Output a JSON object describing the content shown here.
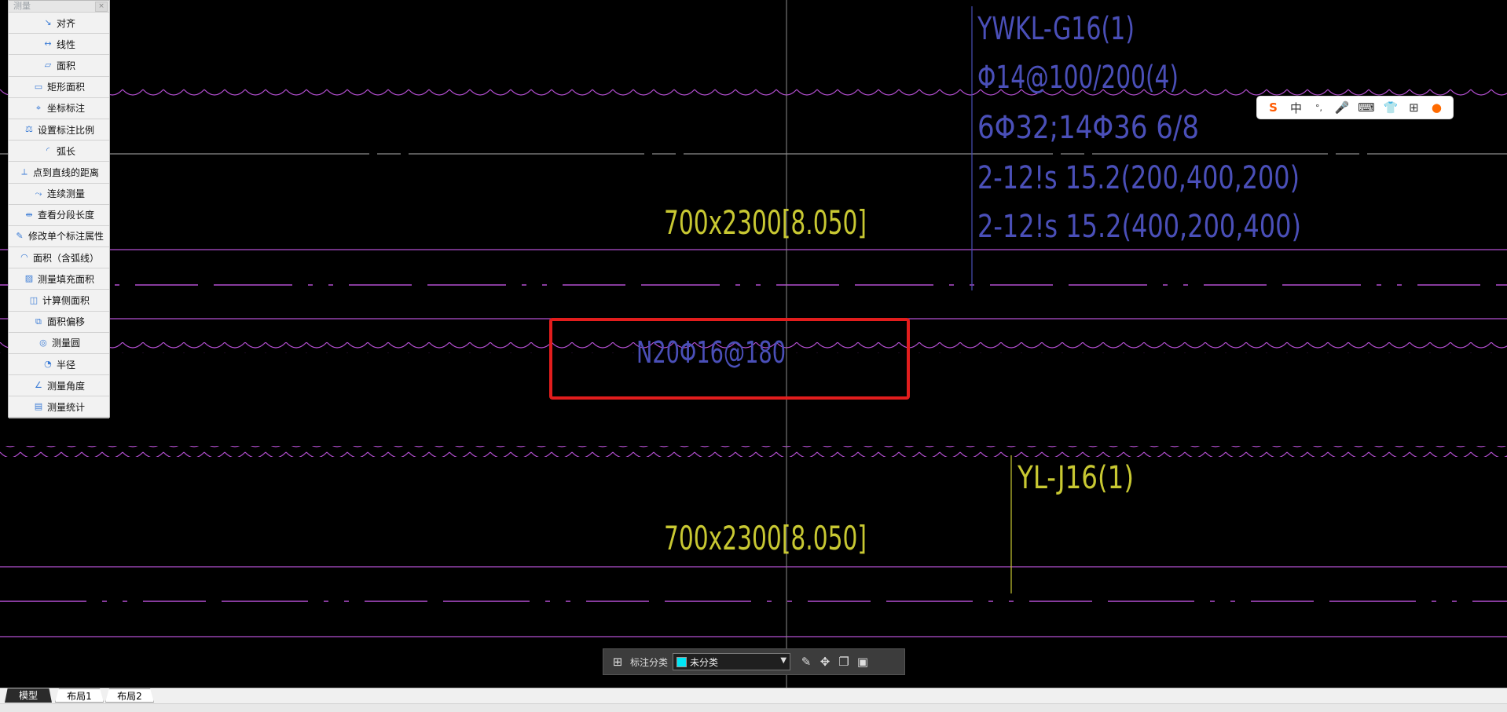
{
  "measure_panel": {
    "title": "测量",
    "items": [
      {
        "label": "对齐",
        "icon": "align-measure-icon"
      },
      {
        "label": "线性",
        "icon": "linear-measure-icon"
      },
      {
        "label": "面积",
        "icon": "area-icon"
      },
      {
        "label": "矩形面积",
        "icon": "rect-area-icon"
      },
      {
        "label": "坐标标注",
        "icon": "coordinate-icon"
      },
      {
        "label": "设置标注比例",
        "icon": "scale-icon"
      },
      {
        "label": "弧长",
        "icon": "arc-length-icon"
      },
      {
        "label": "点到直线的距离",
        "icon": "point-line-distance-icon"
      },
      {
        "label": "连续测量",
        "icon": "continuous-measure-icon"
      },
      {
        "label": "查看分段长度",
        "icon": "segment-length-icon"
      },
      {
        "label": "修改单个标注属性",
        "icon": "edit-dimension-icon"
      },
      {
        "label": "面积（含弧线）",
        "icon": "arc-area-icon"
      },
      {
        "label": "测量填充面积",
        "icon": "fill-area-icon"
      },
      {
        "label": "计算侧面积",
        "icon": "side-area-icon"
      },
      {
        "label": "面积偏移",
        "icon": "area-offset-icon"
      },
      {
        "label": "测量圆",
        "icon": "circle-measure-icon"
      },
      {
        "label": "半径",
        "icon": "radius-icon"
      },
      {
        "label": "测量角度",
        "icon": "angle-icon"
      },
      {
        "label": "测量统计",
        "icon": "statistics-icon"
      }
    ]
  },
  "drawing": {
    "ywkl_label": "YWKL-G16(1)",
    "ywkl_stirrup": "Φ14@100/200(4)",
    "ywkl_main": "6Φ32;14Φ36 6/8",
    "ywkl_side1": "2-12!s 15.2(200,400,200)",
    "ywkl_side2": "2-12!s 15.2(400,200,400)",
    "beam_size_top": "700x2300[8.050]",
    "highlight_text": "N20Φ16@180",
    "yl_label": "YL-J16(1)",
    "beam_size_bottom": "700x2300[8.050]",
    "colors": {
      "magenta": "#b44fd1",
      "blue": "#4a4fb8",
      "yellow": "#c8c832",
      "gray": "#b0b0b0",
      "red": "#e21d1d"
    }
  },
  "ime_toolbar": {
    "icons": [
      "sogou-logo-icon",
      "chinese-mode",
      "punctuation-icon",
      "microphone-icon",
      "keyboard-icon",
      "skin-icon",
      "toolbox-icon",
      "mascot-icon"
    ],
    "mode_label": "中",
    "punct_label": "°,"
  },
  "annotation_toolbar": {
    "label": "标注分类",
    "selected": "未分类"
  },
  "tabs": [
    "模型",
    "布局1",
    "布局2"
  ]
}
